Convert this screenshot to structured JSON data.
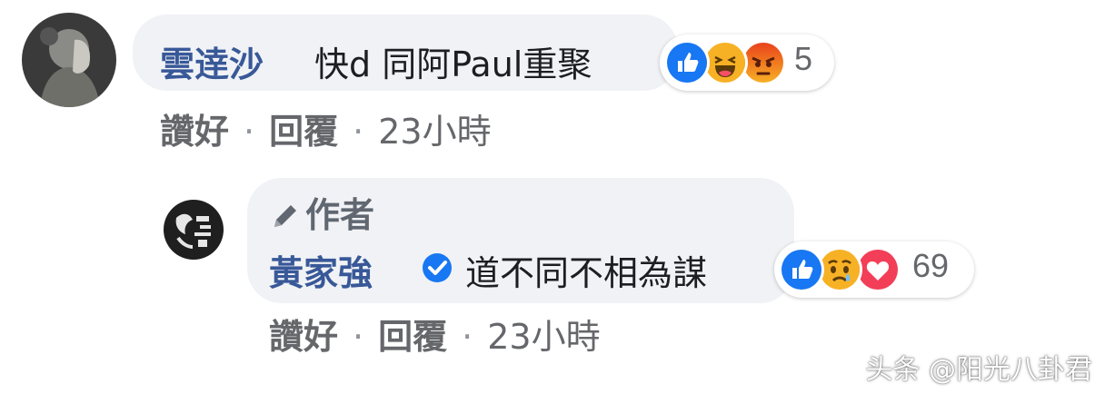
{
  "comment_1": {
    "author": "雲逹沙",
    "text": "快d 同阿Paul重聚",
    "reaction_icons": [
      "like-icon",
      "haha-icon",
      "angry-icon"
    ],
    "reaction_count": "5",
    "actions": {
      "like_label": "讚好",
      "reply_label": "回覆",
      "separator": "·",
      "time": "23小時"
    }
  },
  "comment_2": {
    "badge": "作者",
    "author": "黃家強",
    "verified_icon": "verified-badge-icon",
    "text": "道不同不相為謀",
    "reaction_icons": [
      "like-icon",
      "sad-icon",
      "love-icon"
    ],
    "reaction_count": "69",
    "actions": {
      "like_label": "讚好",
      "reply_label": "回覆",
      "separator": "·",
      "time": "23小時"
    }
  },
  "watermark": "头条 @阳光八卦君",
  "colors": {
    "name_link": "#385898",
    "bubble_bg": "#f0f2f5",
    "like_blue": "#1877f2",
    "love_red": "#f33e58",
    "emoji_yellow": "#f7b125",
    "angry_orange": "#e9710f",
    "meta_gray": "#65676b"
  }
}
